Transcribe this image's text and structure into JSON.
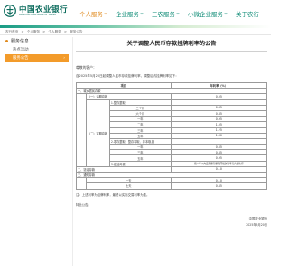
{
  "brand": {
    "name_cn": "中国农业银行",
    "name_en": "AGRICULTURAL BANK OF CHINA",
    "color": "#0b6b5c"
  },
  "topnav": [
    {
      "label": "个人服务",
      "active": true
    },
    {
      "label": "企业服务",
      "active": false
    },
    {
      "label": "三农服务",
      "active": false
    },
    {
      "label": "小微企业服务",
      "active": false
    },
    {
      "label": "关于农行",
      "active": false
    }
  ],
  "breadcrumb": [
    "农行首页",
    ">",
    "个人服务",
    ">",
    "个人服务",
    ">",
    "服务公告"
  ],
  "sidebar": {
    "title": "服务信息",
    "items": [
      {
        "label": "热点活动",
        "active": false
      },
      {
        "label": "服务公告",
        "active": true
      }
    ]
  },
  "article": {
    "title": "关于调整人民币存款挂牌利率的公告",
    "greeting": "尊敬的客户：",
    "intro": "自2025年5月20日起调整人民币存款挂牌利率，调整后的挂牌利率如下：",
    "table": {
      "header_item": "项目",
      "header_rate": "年利率（%）",
      "rows": [
        {
          "cat1": "一、城乡居民存款",
          "cat2": "",
          "name": "",
          "rate": ""
        },
        {
          "cat1": "",
          "cat2": "（一）活期存款",
          "name": "",
          "rate": "0.05"
        },
        {
          "cat1": "",
          "cat2": "",
          "name": "1.整存整取",
          "rate": ""
        },
        {
          "cat1": "",
          "cat2": "",
          "name": "三个月",
          "rate": "0.65"
        },
        {
          "cat1": "",
          "cat2": "",
          "name": "六个月",
          "rate": "0.85"
        },
        {
          "cat1": "",
          "cat2": "",
          "name": "一年",
          "rate": "0.95"
        },
        {
          "cat1": "",
          "cat2": "",
          "name": "二年",
          "rate": "1.05"
        },
        {
          "cat1": "",
          "cat2": "（二）定期存款",
          "name": "三年",
          "rate": "1.25"
        },
        {
          "cat1": "",
          "cat2": "",
          "name": "五年",
          "rate": "1.30"
        },
        {
          "cat1": "",
          "cat2": "",
          "name": "2.零存整取、整存零取、存本取息",
          "rate": ""
        },
        {
          "cat1": "",
          "cat2": "",
          "name": "一年",
          "rate": "0.65"
        },
        {
          "cat1": "",
          "cat2": "",
          "name": "三年",
          "rate": "0.85"
        },
        {
          "cat1": "",
          "cat2": "",
          "name": "五年",
          "rate": "0.95"
        },
        {
          "cat1": "",
          "cat2": "",
          "name": "3.定活两便",
          "rate": "按一年以内定期整存整取同档次利率打六折执行"
        },
        {
          "cat1": "二、协定存款",
          "cat2": "",
          "name": "",
          "rate": "0.10"
        },
        {
          "cat1": "三、通知存款",
          "cat2": "",
          "name": "",
          "rate": ""
        },
        {
          "cat1": "",
          "cat2": "",
          "name": "一天",
          "rate": "0.10"
        },
        {
          "cat1": "",
          "cat2": "",
          "name": "七天",
          "rate": "0.45"
        }
      ]
    },
    "footnote": "注：上述利率为挂牌利率，最终以实际交易利率为准。",
    "closing": "特此公告。",
    "signature": "中国农业银行",
    "date": "2025年5月20日"
  }
}
